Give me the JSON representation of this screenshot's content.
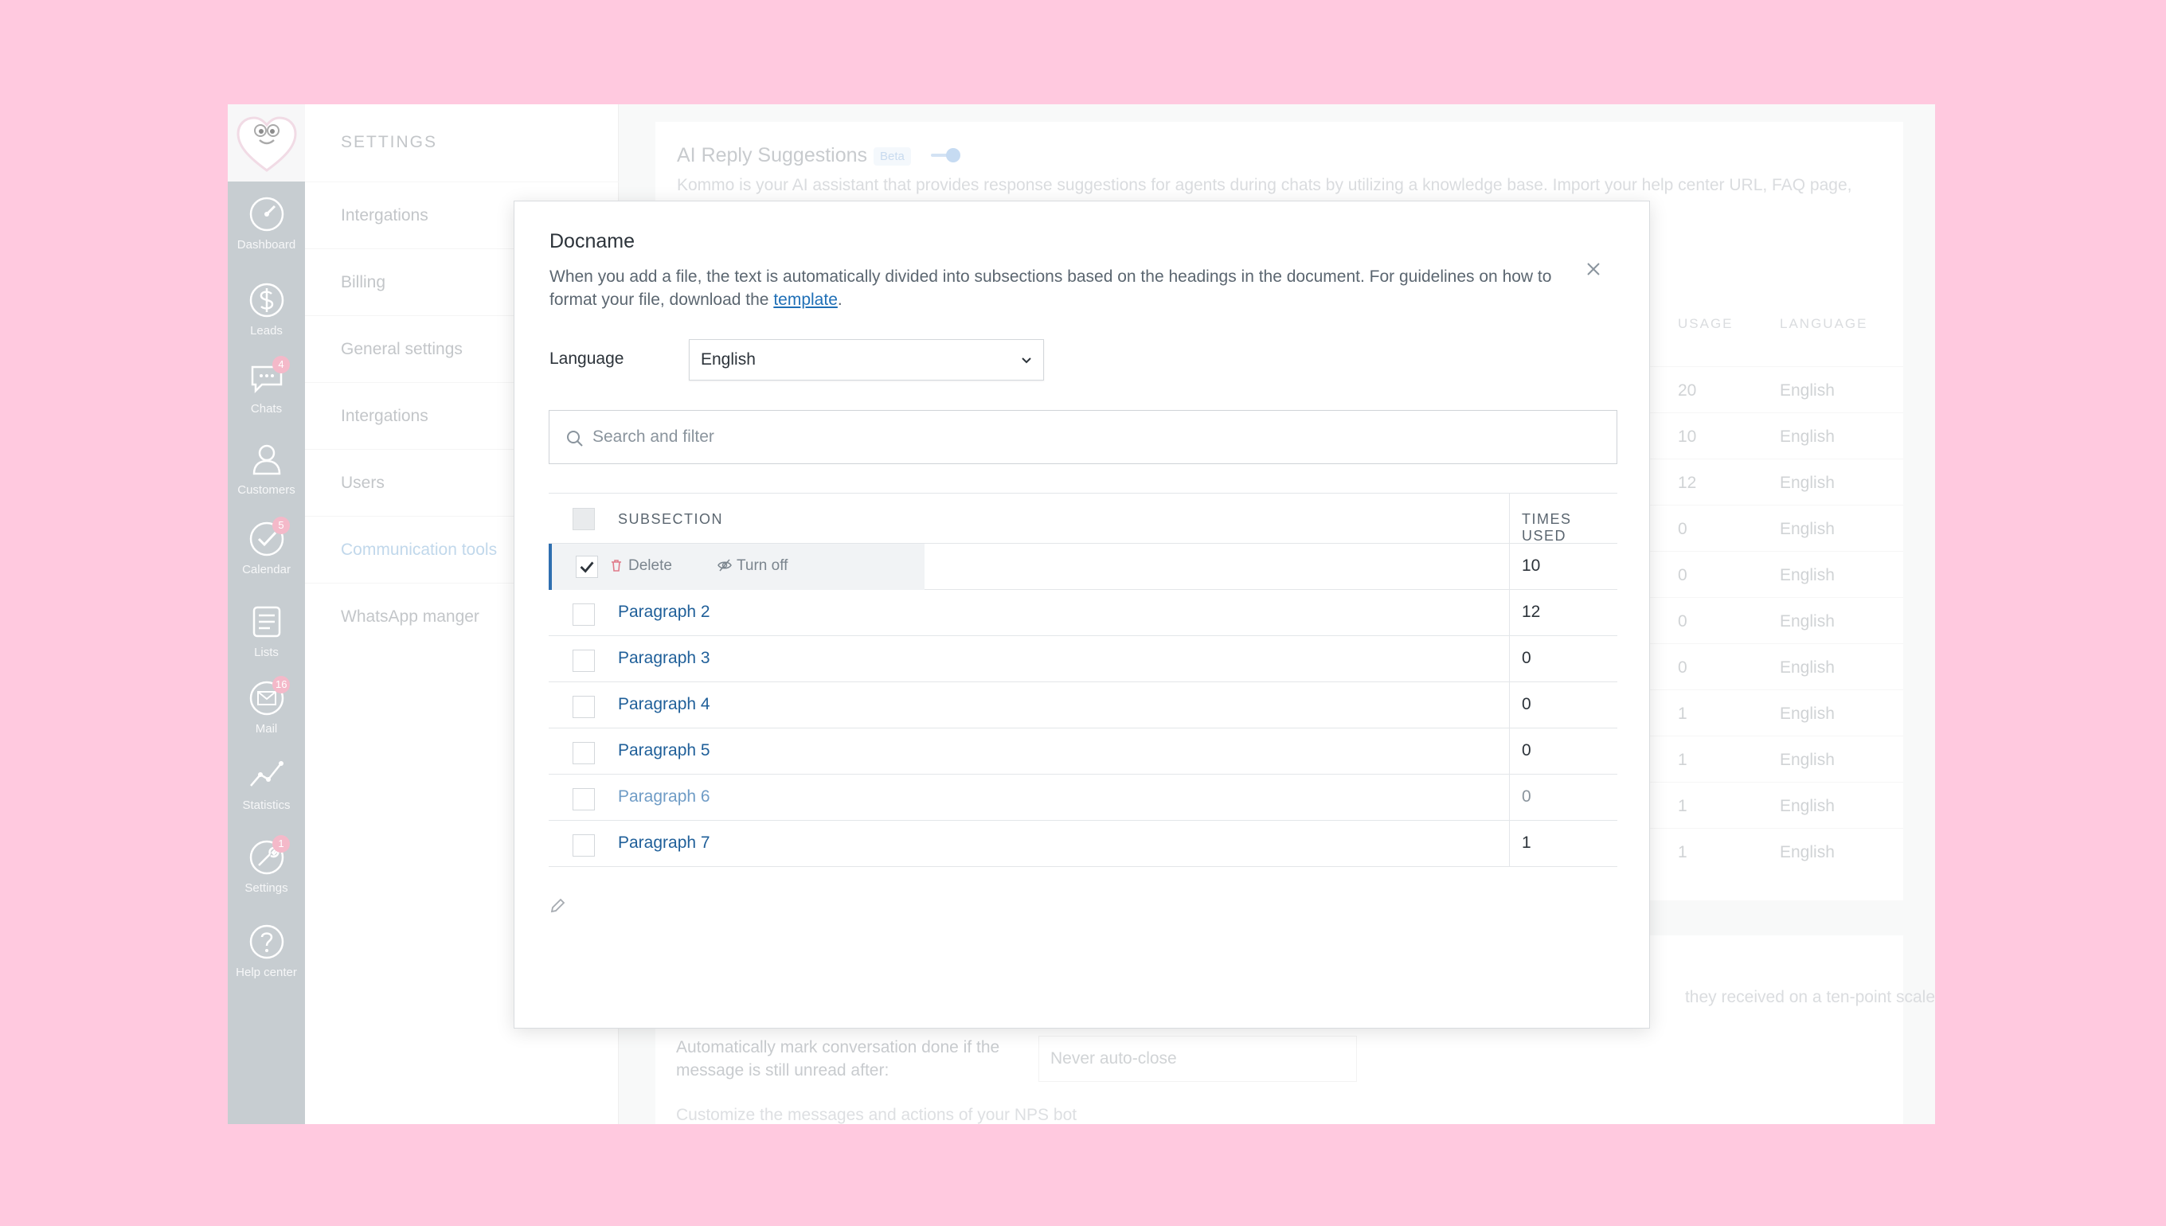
{
  "nav": {
    "items": [
      {
        "label": "Dashboard",
        "icon": "dashboard-icon",
        "badge": ""
      },
      {
        "label": "Leads",
        "icon": "dollar-icon",
        "badge": ""
      },
      {
        "label": "Chats",
        "icon": "chat-icon",
        "badge": "4"
      },
      {
        "label": "Customers",
        "icon": "customers-icon",
        "badge": ""
      },
      {
        "label": "Calendar",
        "icon": "check-icon",
        "badge": "5"
      },
      {
        "label": "Lists",
        "icon": "list-icon",
        "badge": ""
      },
      {
        "label": "Mail",
        "icon": "mail-icon",
        "badge": "16"
      },
      {
        "label": "Statistics",
        "icon": "statistics-icon",
        "badge": ""
      },
      {
        "label": "Settings",
        "icon": "wrench-icon",
        "badge": "1"
      },
      {
        "label": "Help center",
        "icon": "help-icon",
        "badge": ""
      }
    ]
  },
  "settings": {
    "title": "SETTINGS",
    "items": [
      {
        "label": "Intergations"
      },
      {
        "label": "Billing"
      },
      {
        "label": "General settings"
      },
      {
        "label": "Intergations"
      },
      {
        "label": "Users"
      },
      {
        "label": "Communication tools"
      },
      {
        "label": "WhatsApp manger"
      }
    ]
  },
  "background": {
    "ai_title": "AI Reply Suggestions",
    "ai_beta": "Beta",
    "ai_desc": "Kommo is your AI assistant that provides response suggestions for agents during chats by utilizing a knowledge base. Import your help center URL, FAQ page,",
    "col_usage": "USAGE",
    "col_language": "LANGUAGE",
    "rows": [
      {
        "usage": "20",
        "language": "English"
      },
      {
        "usage": "10",
        "language": "English"
      },
      {
        "usage": "12",
        "language": "English"
      },
      {
        "usage": "0",
        "language": "English"
      },
      {
        "usage": "0",
        "language": "English"
      },
      {
        "usage": "0",
        "language": "English"
      },
      {
        "usage": "0",
        "language": "English"
      },
      {
        "usage": "1",
        "language": "English"
      },
      {
        "usage": "1",
        "language": "English"
      },
      {
        "usage": "1",
        "language": "English"
      },
      {
        "usage": "1",
        "language": "English"
      }
    ],
    "nps_fragment": "they received on a ten-point scale",
    "autoclose_label": "Automatically mark conversation done if the message is still unread after:",
    "autoclose_value": "Never auto-close",
    "customize_text": "Customize the messages and actions of your NPS bot"
  },
  "modal": {
    "title": "Docname",
    "desc_prefix": "When you add a file, the text is automatically divided into subsections based on the headings in the document. For guidelines on how to format your file, download the ",
    "desc_link": "template",
    "desc_suffix": ".",
    "language_label": "Language",
    "language_value": "English",
    "search_placeholder": "Search and filter",
    "col_subsection": "SUBSECTION",
    "col_times_used": "TIMES USED",
    "selected_row": {
      "times_used": "10",
      "delete_label": "Delete",
      "turnoff_label": "Turn off"
    },
    "rows": [
      {
        "name": "Paragraph 2",
        "times_used": "12"
      },
      {
        "name": "Paragraph 3",
        "times_used": "0"
      },
      {
        "name": "Paragraph 4",
        "times_used": "0"
      },
      {
        "name": "Paragraph 5",
        "times_used": "0"
      },
      {
        "name": "Paragraph 6",
        "times_used": "0"
      },
      {
        "name": "Paragraph 7",
        "times_used": "1"
      }
    ]
  },
  "colors": {
    "page_background": "#ffc9df",
    "nav_background": "#a5aeb5",
    "link": "#1f5f99",
    "selection_accent": "#2f6fb0",
    "badge": "#ee8fa9"
  }
}
